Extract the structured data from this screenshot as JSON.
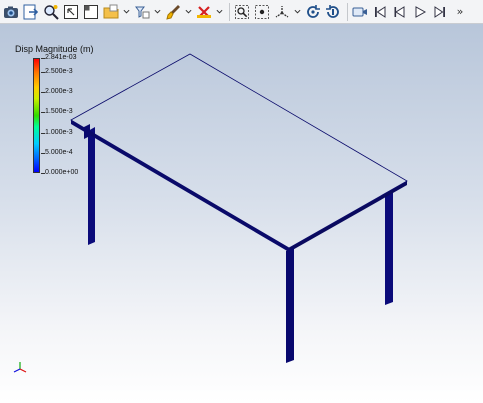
{
  "toolbar": {
    "buttons": [
      {
        "name": "camera-icon"
      },
      {
        "name": "export-screenshot-icon"
      },
      {
        "name": "query-magnifier-icon"
      },
      {
        "name": "select-window-icon"
      },
      {
        "name": "clip-box-icon"
      },
      {
        "name": "open-folder-icon"
      },
      {
        "name": "layer-filter-icon"
      },
      {
        "name": "paint-brush-icon"
      },
      {
        "name": "clear-eraser-icon"
      },
      {
        "name": "zoom-fit-icon"
      },
      {
        "name": "zoom-to-box-icon"
      },
      {
        "name": "axis-orient-icon"
      },
      {
        "name": "reset-camera-icon"
      },
      {
        "name": "rotate-view-icon"
      },
      {
        "name": "record-video-icon"
      },
      {
        "name": "first-frame-icon"
      },
      {
        "name": "previous-frame-icon"
      },
      {
        "name": "play-icon"
      },
      {
        "name": "last-frame-icon"
      },
      {
        "name": "more-icon"
      }
    ],
    "more_label": "»"
  },
  "legend": {
    "title": "Disp Magnitude (m)",
    "max_label": "2.841e-03",
    "labels": [
      "2.500e-3",
      "2.000e-3",
      "1.500e-3",
      "1.000e-3",
      "5.000e-4",
      "0.000e+00"
    ],
    "min_value": 0,
    "max_value": 0.002841,
    "label_values": [
      0.0025,
      0.002,
      0.0015,
      0.001,
      0.0005,
      0
    ]
  },
  "colors": {
    "table_legs": "#06066e",
    "edge": "#0a0a6a",
    "accent": "#ff0000"
  }
}
